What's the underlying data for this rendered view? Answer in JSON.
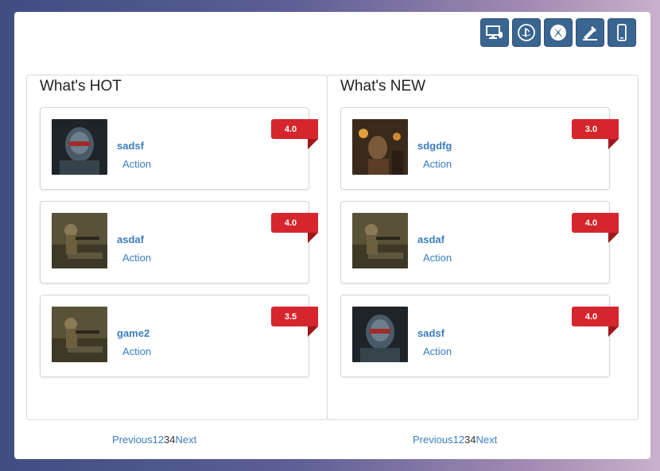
{
  "platforms": [
    {
      "icon": "desktop-icon"
    },
    {
      "icon": "playstation-icon"
    },
    {
      "icon": "xbox-icon"
    },
    {
      "icon": "tools-icon"
    },
    {
      "icon": "mobile-icon"
    }
  ],
  "hot": {
    "title": "What's HOT",
    "items": [
      {
        "name": "sadsf",
        "genre": "Action",
        "rating": "4.0"
      },
      {
        "name": "asdaf",
        "genre": "Action",
        "rating": "4.0"
      },
      {
        "name": "game2",
        "genre": "Action",
        "rating": "3.5"
      }
    ],
    "pager": {
      "prev": "Previous",
      "p1": "1",
      "p2": "2",
      "p3": "3",
      "p4": "4",
      "next": "Next"
    }
  },
  "new": {
    "title": "What's NEW",
    "items": [
      {
        "name": "sdgdfg",
        "genre": "Action",
        "rating": "3.0"
      },
      {
        "name": "asdaf",
        "genre": "Action",
        "rating": "4.0"
      },
      {
        "name": "sadsf",
        "genre": "Action",
        "rating": "4.0"
      }
    ],
    "pager": {
      "prev": "Previous",
      "p1": "1",
      "p2": "2",
      "p3": "3",
      "p4": "4",
      "next": "Next"
    }
  },
  "colors": {
    "accent": "#3a6591",
    "link": "#3a7dbf",
    "ribbon": "#d6262d"
  }
}
